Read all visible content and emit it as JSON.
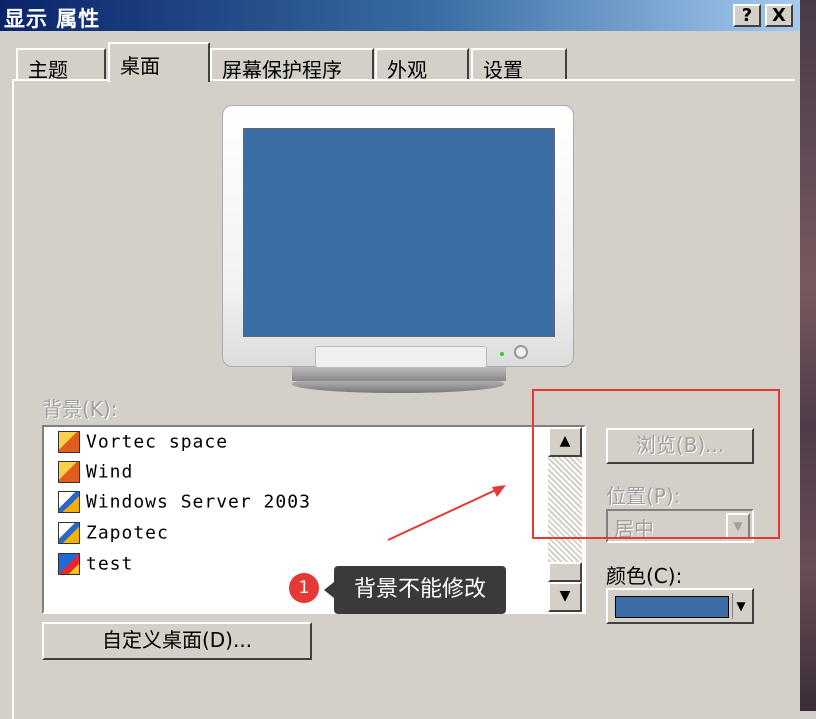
{
  "window": {
    "title": "显示 属性",
    "help_label": "?",
    "close_label": "X"
  },
  "tabs": [
    {
      "label": "主题"
    },
    {
      "label": "桌面"
    },
    {
      "label": "屏幕保护程序"
    },
    {
      "label": "外观"
    },
    {
      "label": "设置"
    }
  ],
  "active_tab": "桌面",
  "preview": {
    "screen_color": "#3a6ea5"
  },
  "background": {
    "label": "背景(K):",
    "items": [
      {
        "name": "Vortec space",
        "icon": "html-file-icon"
      },
      {
        "name": "Wind",
        "icon": "html-file-icon"
      },
      {
        "name": "Windows Server 2003",
        "icon": "bitmap-file-icon"
      },
      {
        "name": "Zapotec",
        "icon": "bitmap-file-icon"
      },
      {
        "name": "test",
        "icon": "image-file-icon"
      }
    ]
  },
  "buttons": {
    "browse": "浏览(B)...",
    "customize_desktop": "自定义桌面(D)..."
  },
  "position": {
    "label": "位置(P):",
    "value": "居中"
  },
  "color": {
    "label": "颜色(C):",
    "value": "#3a6ea5"
  },
  "annotation": {
    "number": "1",
    "text": "背景不能修改",
    "color": "#e53935"
  },
  "scrollbar": {
    "up_icon": "▲",
    "down_icon": "▼"
  },
  "combo_arrow": "▼"
}
